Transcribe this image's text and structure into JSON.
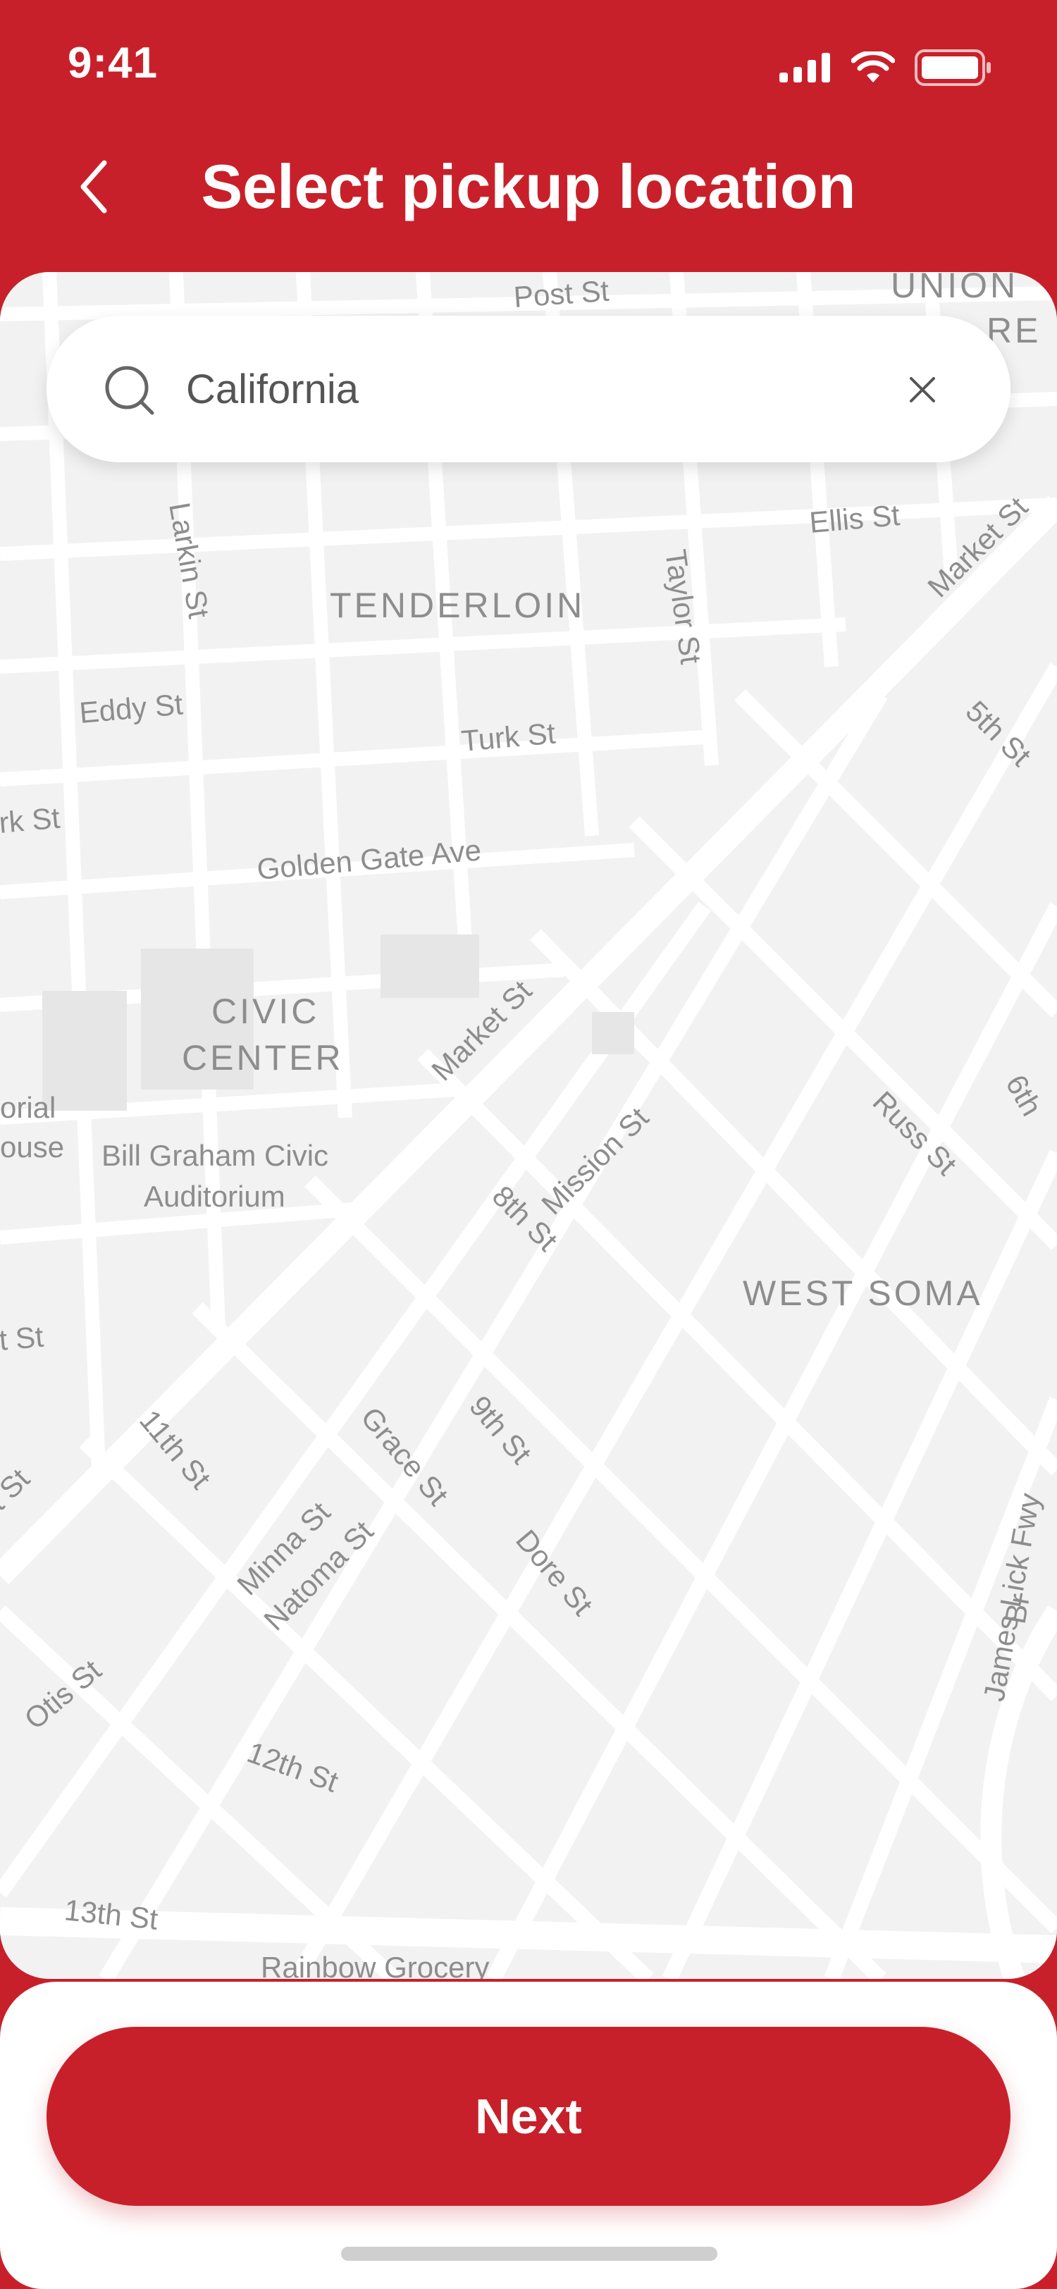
{
  "status": {
    "time": "9:41"
  },
  "header": {
    "title": "Select pickup location",
    "back_icon": "chevron-left-icon"
  },
  "search": {
    "value": "California",
    "search_icon": "search-icon",
    "clear_icon": "close-icon"
  },
  "map": {
    "districts": [
      "TENDERLOIN",
      "CIVIC",
      "CENTER",
      "WEST SOMA",
      "UNION",
      "RE"
    ],
    "streets": [
      "Post St",
      "Ellis St",
      "Larkin St",
      "Taylor St",
      "Eddy St",
      "Turk St",
      "Golden Gate Ave",
      "rk St",
      "Market St",
      "Market St",
      "5th St",
      "Mission St",
      "8th St",
      "Russ St",
      "6th",
      "orial",
      "ouse",
      "Bill Graham Civic",
      "Auditorium",
      "t St",
      "11th St",
      "Grace St",
      "9th St",
      "Minna St",
      "Natoma St",
      "Dore St",
      "James Lick Fwy",
      "Br",
      "t St",
      "Otis St",
      "12th St",
      "13th St",
      "Rainbow Grocery"
    ]
  },
  "actions": {
    "next_label": "Next"
  }
}
